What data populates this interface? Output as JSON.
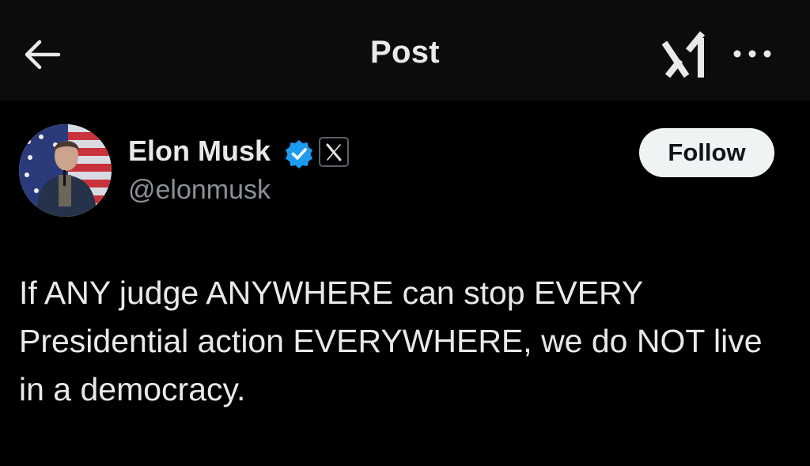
{
  "header": {
    "title": "Post",
    "back_icon": "arrow-left-icon",
    "grok_icon": "grok-icon",
    "more_icon": "more-horizontal-icon"
  },
  "author": {
    "name": "Elon Musk",
    "handle": "@elonmusk",
    "verified_icon": "verified-badge-icon",
    "affiliate_icon": "x-logo-icon",
    "verified_color": "#1d9bf0"
  },
  "follow_button": {
    "label": "Follow"
  },
  "post": {
    "text": "If ANY judge ANYWHERE can stop EVERY Presidential action EVERYWHERE, we do NOT live in a democracy."
  },
  "colors": {
    "background": "#000000",
    "header_background": "#0c0c0c",
    "text_primary": "#e7e9ea",
    "text_secondary": "#8b9096",
    "follow_bg": "#eff3f4",
    "follow_text": "#0f1419"
  }
}
